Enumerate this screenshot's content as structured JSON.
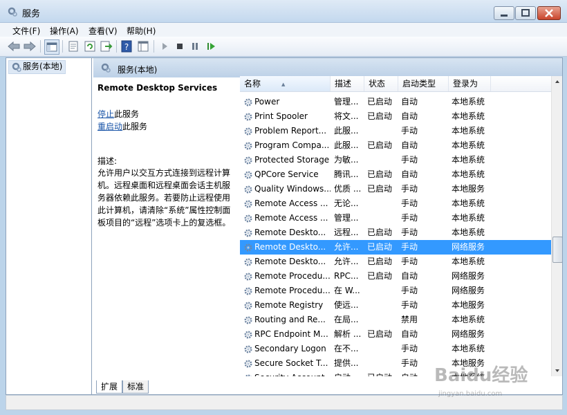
{
  "window": {
    "title": "服务"
  },
  "menu": [
    "文件(F)",
    "操作(A)",
    "查看(V)",
    "帮助(H)"
  ],
  "toolbar_icons": [
    "back-arrow-icon",
    "forward-arrow-icon",
    "show-hide-tree-icon",
    "properties-icon",
    "refresh-icon",
    "export-list-icon",
    "help-icon",
    "console-view-icon",
    "start-service-icon",
    "stop-service-icon",
    "pause-service-icon",
    "resume-service-icon"
  ],
  "tree": {
    "root_label": "服务(本地)"
  },
  "panel": {
    "header": "服务(本地)"
  },
  "details": {
    "service_name": "Remote Desktop Services",
    "stop_link": "停止",
    "stop_suffix": "此服务",
    "restart_link": "重启动",
    "restart_suffix": "此服务",
    "description_label": "描述:",
    "description": "允许用户以交互方式连接到远程计算机。远程桌面和远程桌面会话主机服务器依赖此服务。若要防止远程使用此计算机，请清除“系统”属性控制面板项目的“远程”选项卡上的复选框。"
  },
  "columns": [
    "名称",
    "描述",
    "状态",
    "启动类型",
    "登录为"
  ],
  "services": [
    {
      "name": "Power",
      "desc": "管理...",
      "status": "已启动",
      "startup": "自动",
      "logon": "本地系统"
    },
    {
      "name": "Print Spooler",
      "desc": "将文...",
      "status": "已启动",
      "startup": "自动",
      "logon": "本地系统"
    },
    {
      "name": "Problem Report...",
      "desc": "此服...",
      "status": "",
      "startup": "手动",
      "logon": "本地系统"
    },
    {
      "name": "Program Compa...",
      "desc": "此服...",
      "status": "已启动",
      "startup": "自动",
      "logon": "本地系统"
    },
    {
      "name": "Protected Storage",
      "desc": "为敏...",
      "status": "",
      "startup": "手动",
      "logon": "本地系统"
    },
    {
      "name": "QPCore Service",
      "desc": "腾讯...",
      "status": "已启动",
      "startup": "自动",
      "logon": "本地系统"
    },
    {
      "name": "Quality Windows...",
      "desc": "优质 ...",
      "status": "已启动",
      "startup": "手动",
      "logon": "本地服务"
    },
    {
      "name": "Remote Access ...",
      "desc": "无论...",
      "status": "",
      "startup": "手动",
      "logon": "本地系统"
    },
    {
      "name": "Remote Access ...",
      "desc": "管理...",
      "status": "",
      "startup": "手动",
      "logon": "本地系统"
    },
    {
      "name": "Remote Deskto...",
      "desc": "远程...",
      "status": "已启动",
      "startup": "手动",
      "logon": "本地系统"
    },
    {
      "name": "Remote Deskto...",
      "desc": "允许...",
      "status": "已启动",
      "startup": "手动",
      "logon": "网络服务",
      "selected": true
    },
    {
      "name": "Remote Deskto...",
      "desc": "允许...",
      "status": "已启动",
      "startup": "手动",
      "logon": "本地系统"
    },
    {
      "name": "Remote Procedu...",
      "desc": "RPC...",
      "status": "已启动",
      "startup": "自动",
      "logon": "网络服务"
    },
    {
      "name": "Remote Procedu...",
      "desc": "在 W...",
      "status": "",
      "startup": "手动",
      "logon": "网络服务"
    },
    {
      "name": "Remote Registry",
      "desc": "使远...",
      "status": "",
      "startup": "手动",
      "logon": "本地服务"
    },
    {
      "name": "Routing and Re...",
      "desc": "在局...",
      "status": "",
      "startup": "禁用",
      "logon": "本地系统"
    },
    {
      "name": "RPC Endpoint M...",
      "desc": "解析 ...",
      "status": "已启动",
      "startup": "自动",
      "logon": "网络服务"
    },
    {
      "name": "Secondary Logon",
      "desc": "在不...",
      "status": "",
      "startup": "手动",
      "logon": "本地系统"
    },
    {
      "name": "Secure Socket T...",
      "desc": "提供...",
      "status": "",
      "startup": "手动",
      "logon": "本地服务"
    },
    {
      "name": "Security Account...",
      "desc": "启动...",
      "status": "已启动",
      "startup": "自动",
      "logon": "本地系统"
    }
  ],
  "tabs": [
    "扩展",
    "标准"
  ],
  "watermark": {
    "text": "Baidu经验",
    "sub": "jingyan.baidu.com"
  }
}
